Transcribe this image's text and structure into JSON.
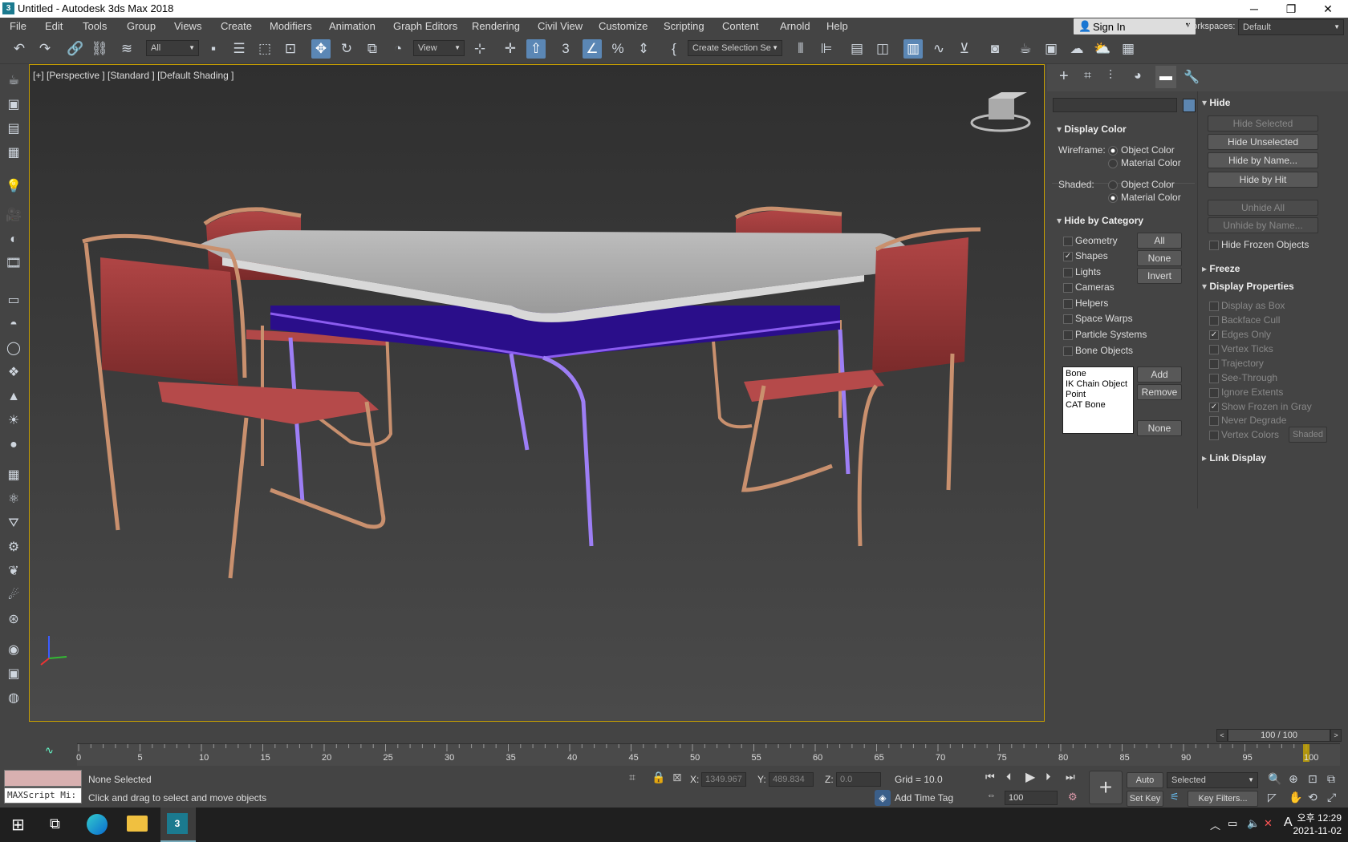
{
  "titlebar": {
    "title": "Untitled - Autodesk 3ds Max 2018",
    "minimize": "─",
    "maximize": "❐",
    "close": "✕"
  },
  "menus": [
    "File",
    "Edit",
    "Tools",
    "Group",
    "Views",
    "Create",
    "Modifiers",
    "Animation",
    "Graph Editors",
    "Rendering",
    "Civil View",
    "Customize",
    "Scripting",
    "Content",
    "Arnold",
    "Help"
  ],
  "account": {
    "sign_in": "Sign In",
    "workspaces_label": "Workspaces:",
    "workspace_value": "Default"
  },
  "toolbar": {
    "filter_value": "All",
    "ref_coord_value": "View",
    "selection_set_value": "Create Selection Se"
  },
  "viewport": {
    "label": "[+] [Perspective ] [Standard ] [Default Shading ]"
  },
  "command_panel": {
    "display_color": {
      "title": "Display Color",
      "wireframe_label": "Wireframe:",
      "shaded_label": "Shaded:",
      "object_color": "Object Color",
      "material_color": "Material Color"
    },
    "hide_by_category": {
      "title": "Hide by Category",
      "categories": [
        "Geometry",
        "Shapes",
        "Lights",
        "Cameras",
        "Helpers",
        "Space Warps",
        "Particle Systems",
        "Bone Objects"
      ],
      "all": "All",
      "none": "None",
      "invert": "Invert",
      "list": [
        "Bone",
        "IK Chain Object",
        "Point",
        "CAT Bone"
      ],
      "add": "Add",
      "remove": "Remove",
      "none2": "None"
    },
    "hide": {
      "title": "Hide",
      "hide_selected": "Hide Selected",
      "hide_unselected": "Hide Unselected",
      "hide_by_name": "Hide by Name...",
      "hide_by_hit": "Hide by Hit",
      "unhide_all": "Unhide All",
      "unhide_by_name": "Unhide by Name...",
      "hide_frozen": "Hide Frozen Objects"
    },
    "freeze": {
      "title": "Freeze"
    },
    "display_properties": {
      "title": "Display Properties",
      "items": [
        "Display as Box",
        "Backface Cull",
        "Edges Only",
        "Vertex Ticks",
        "Trajectory",
        "See-Through",
        "Ignore Extents",
        "Show Frozen in Gray",
        "Never Degrade",
        "Vertex Colors"
      ],
      "shaded": "Shaded"
    },
    "link_display": {
      "title": "Link Display"
    }
  },
  "timeline": {
    "frame": "100 / 100",
    "ticks": [
      "0",
      "5",
      "10",
      "15",
      "20",
      "25",
      "30",
      "35",
      "40",
      "45",
      "50",
      "55",
      "60",
      "65",
      "70",
      "75",
      "80",
      "85",
      "90",
      "95",
      "100"
    ]
  },
  "status": {
    "maxscript": "MAXScript Mi:",
    "selection": "None Selected",
    "prompt": "Click and drag to select and move objects",
    "x_label": "X:",
    "x": "1349.967",
    "y_label": "Y:",
    "y": "489.834",
    "z_label": "Z:",
    "z": "0.0",
    "grid": "Grid = 10.0",
    "add_time_tag": "Add Time Tag",
    "auto_key": "Auto Key",
    "set_key": "Set Key",
    "selected": "Selected",
    "frame_field": "100",
    "key_filters": "Key Filters..."
  },
  "taskbar": {
    "ime": "오후",
    "time": "12:29",
    "date": "2021-11-02",
    "ime_letter": "A"
  }
}
